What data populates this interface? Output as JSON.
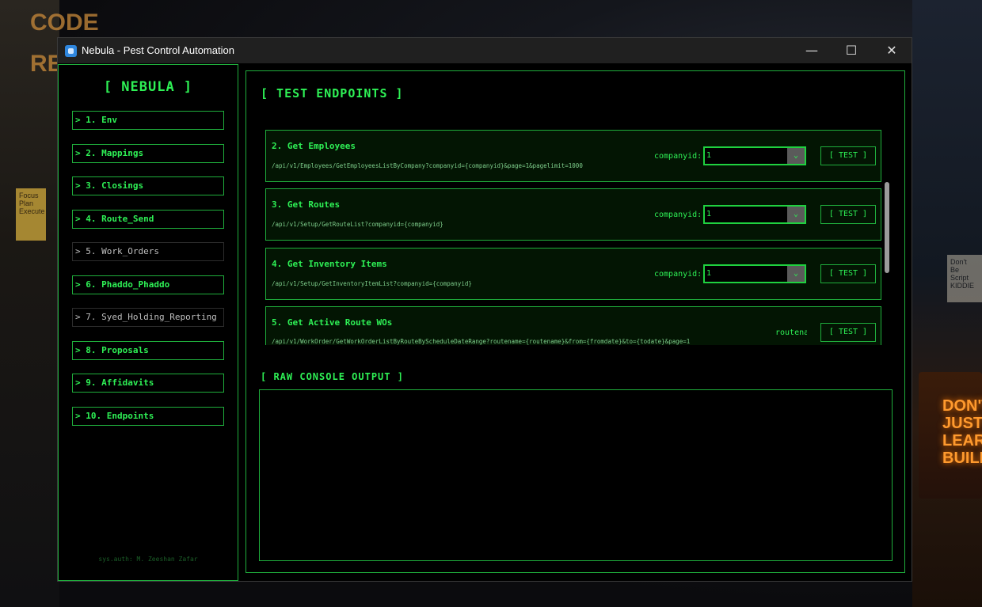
{
  "wallpaper": {
    "left_text": [
      "CODE",
      "REP"
    ],
    "sticky_note": [
      "Focus",
      "Plan",
      "Execute"
    ],
    "right_sign": [
      "DON'T",
      "JUST",
      "LEARN",
      "BUILD"
    ],
    "right_note": [
      "Don't",
      "Be",
      "Script",
      "KIDDIE"
    ]
  },
  "window": {
    "title": "Nebula - Pest Control Automation",
    "minimize_glyph": "—",
    "maximize_glyph": "☐",
    "close_glyph": "✕"
  },
  "sidebar": {
    "brand": "[ NEBULA ]",
    "items": [
      {
        "label": "> 1. Env",
        "style": "active"
      },
      {
        "label": "> 2. Mappings",
        "style": "active"
      },
      {
        "label": "> 3. Closings",
        "style": "active"
      },
      {
        "label": "> 4. Route_Send",
        "style": "active"
      },
      {
        "label": "> 5. Work_Orders",
        "style": "dim"
      },
      {
        "label": "> 6. Phaddo_Phaddo",
        "style": "active"
      },
      {
        "label": "> 7. Syed_Holding_Reporting",
        "style": "dim"
      },
      {
        "label": "> 8. Proposals",
        "style": "active"
      },
      {
        "label": "> 9. Affidavits",
        "style": "active"
      },
      {
        "label": "> 10. Endpoints",
        "style": "active"
      }
    ],
    "footer": "sys.auth: M. Zeeshan Zafar"
  },
  "main": {
    "title": "[ TEST ENDPOINTS ]",
    "endpoints": [
      {
        "title": "2. Get Employees",
        "path": "/api/v1/Employees/GetEmployeesListByCompany?companyid={companyid}&page=1&pagelimit=1000",
        "param_label": "companyid:",
        "param_value": "1",
        "button": "[ TEST ]"
      },
      {
        "title": "3. Get Routes",
        "path": "/api/v1/Setup/GetRouteList?companyid={companyid}",
        "param_label": "companyid:",
        "param_value": "1",
        "button": "[ TEST ]"
      },
      {
        "title": "4. Get Inventory Items",
        "path": "/api/v1/Setup/GetInventoryItemList?companyid={companyid}",
        "param_label": "companyid:",
        "param_value": "1",
        "button": "[ TEST ]"
      },
      {
        "title": "5. Get Active Route WOs",
        "path": "/api/v1/WorkOrder/GetWorkOrderListByRouteByScheduleDateRange?routename={routename}&from={fromdate}&to={todate}&page=1",
        "param_label": "routena",
        "button": "[ TEST ]"
      }
    ],
    "console_title": "[ RAW CONSOLE OUTPUT ]",
    "console_output": ""
  },
  "colors": {
    "accent": "#2ef055",
    "border": "#1fae3c",
    "background": "#000000"
  }
}
